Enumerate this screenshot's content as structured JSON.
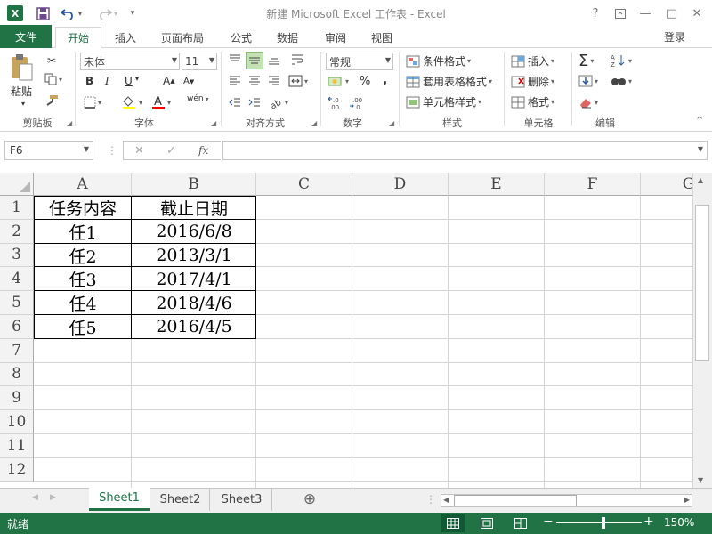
{
  "window": {
    "title": "新建 Microsoft Excel 工作表 - Excel",
    "app_logo": "X",
    "qa_save_icon": "save-icon",
    "qa_undo_icon": "undo-icon",
    "qa_redo_icon": "redo-icon",
    "help": "?",
    "minimize": "—",
    "restore": "□",
    "close": "✕"
  },
  "tabs": {
    "file": "文件",
    "home": "开始",
    "insert": "插入",
    "page_layout": "页面布局",
    "formulas": "公式",
    "data": "数据",
    "review": "审阅",
    "view": "视图",
    "login": "登录"
  },
  "ribbon": {
    "clipboard": {
      "paste": "粘贴",
      "label": "剪贴板"
    },
    "font": {
      "font_name": "宋体",
      "font_size": "11",
      "bold": "B",
      "italic": "I",
      "underline": "U",
      "grow": "A",
      "shrink": "A",
      "wen": "wén",
      "label": "字体"
    },
    "alignment": {
      "label": "对齐方式"
    },
    "number": {
      "format": "常规",
      "percent": "%",
      "comma": ",",
      "label": "数字"
    },
    "styles": {
      "conditional": "条件格式",
      "table": "套用表格格式",
      "cell_styles": "单元格样式",
      "label": "样式"
    },
    "cells": {
      "insert": "插入",
      "delete": "删除",
      "format": "格式",
      "label": "单元格"
    },
    "editing": {
      "label": "编辑"
    }
  },
  "formula_bar": {
    "name_box": "F6",
    "cancel": "✕",
    "enter": "✓",
    "fx": "fx",
    "formula": ""
  },
  "grid": {
    "columns": [
      "A",
      "B",
      "C",
      "D",
      "E",
      "F",
      "G"
    ],
    "rows": [
      "1",
      "2",
      "3",
      "4",
      "5",
      "6",
      "7",
      "8",
      "9",
      "10",
      "11",
      "12"
    ],
    "cells": [
      [
        "任务内容",
        "截止日期"
      ],
      [
        "任1",
        "2016/6/8"
      ],
      [
        "任2",
        "2013/3/1"
      ],
      [
        "任3",
        "2017/4/1"
      ],
      [
        "任4",
        "2018/4/6"
      ],
      [
        "任5",
        "2016/4/5"
      ]
    ]
  },
  "sheets": [
    "Sheet1",
    "Sheet2",
    "Sheet3"
  ],
  "add_sheet": "⊕",
  "status": {
    "ready": "就绪",
    "zoom": "150%",
    "zoom_minus": "−",
    "zoom_plus": "+"
  },
  "colors": {
    "accent": "#217346",
    "status_bar": "#217346"
  }
}
